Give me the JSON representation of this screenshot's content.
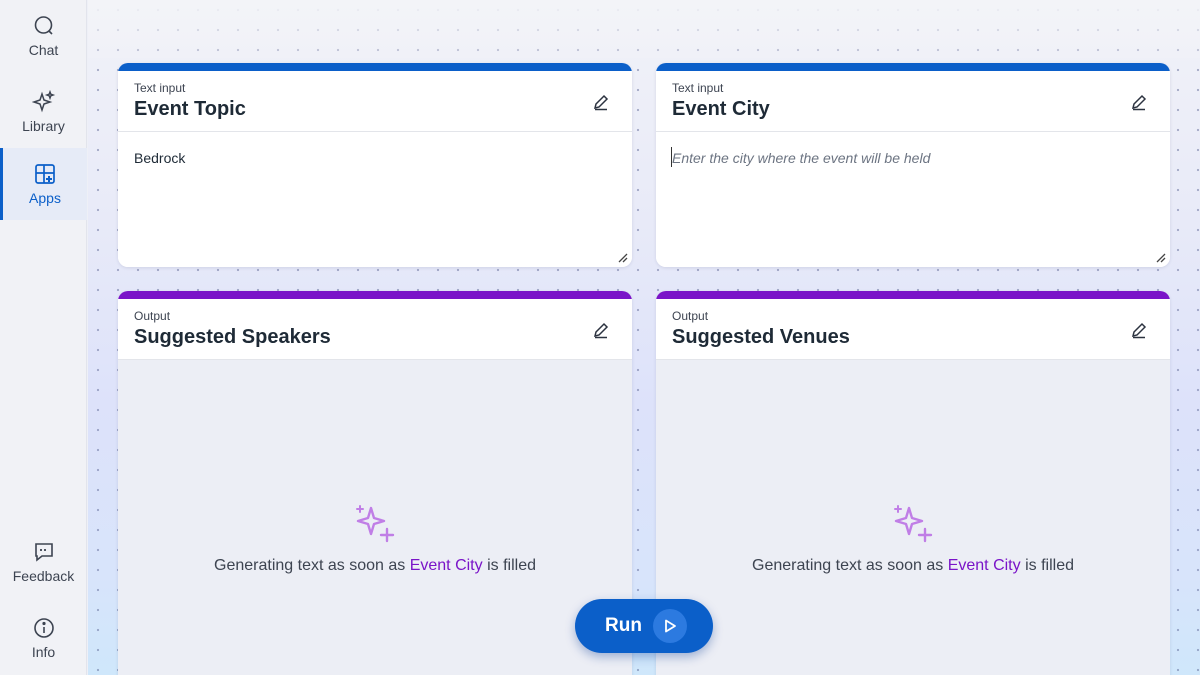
{
  "sidebar": {
    "items": [
      {
        "label": "Chat",
        "icon": "chat-icon"
      },
      {
        "label": "Library",
        "icon": "sparkle-icon"
      },
      {
        "label": "Apps",
        "icon": "apps-icon",
        "active": true
      },
      {
        "label": "Feedback",
        "icon": "feedback-icon"
      },
      {
        "label": "Info",
        "icon": "info-icon"
      }
    ]
  },
  "cards": {
    "event_topic": {
      "kind": "Text input",
      "title": "Event Topic",
      "value": "Bedrock"
    },
    "event_city": {
      "kind": "Text input",
      "title": "Event City",
      "placeholder": "Enter the city where the event will be held"
    },
    "suggested_speakers": {
      "kind": "Output",
      "title": "Suggested Speakers",
      "gen_prefix": "Generating text as soon as",
      "gen_field": "Event City",
      "gen_suffix": "is filled"
    },
    "suggested_venues": {
      "kind": "Output",
      "title": "Suggested Venues",
      "gen_prefix": "Generating text as soon as",
      "gen_field": "Event City",
      "gen_suffix": "is filled"
    }
  },
  "run_button": {
    "label": "Run"
  },
  "colors": {
    "input_accent": "#0b5fc9",
    "output_accent": "#7a14c8",
    "sparkle": "#c07ee6"
  }
}
